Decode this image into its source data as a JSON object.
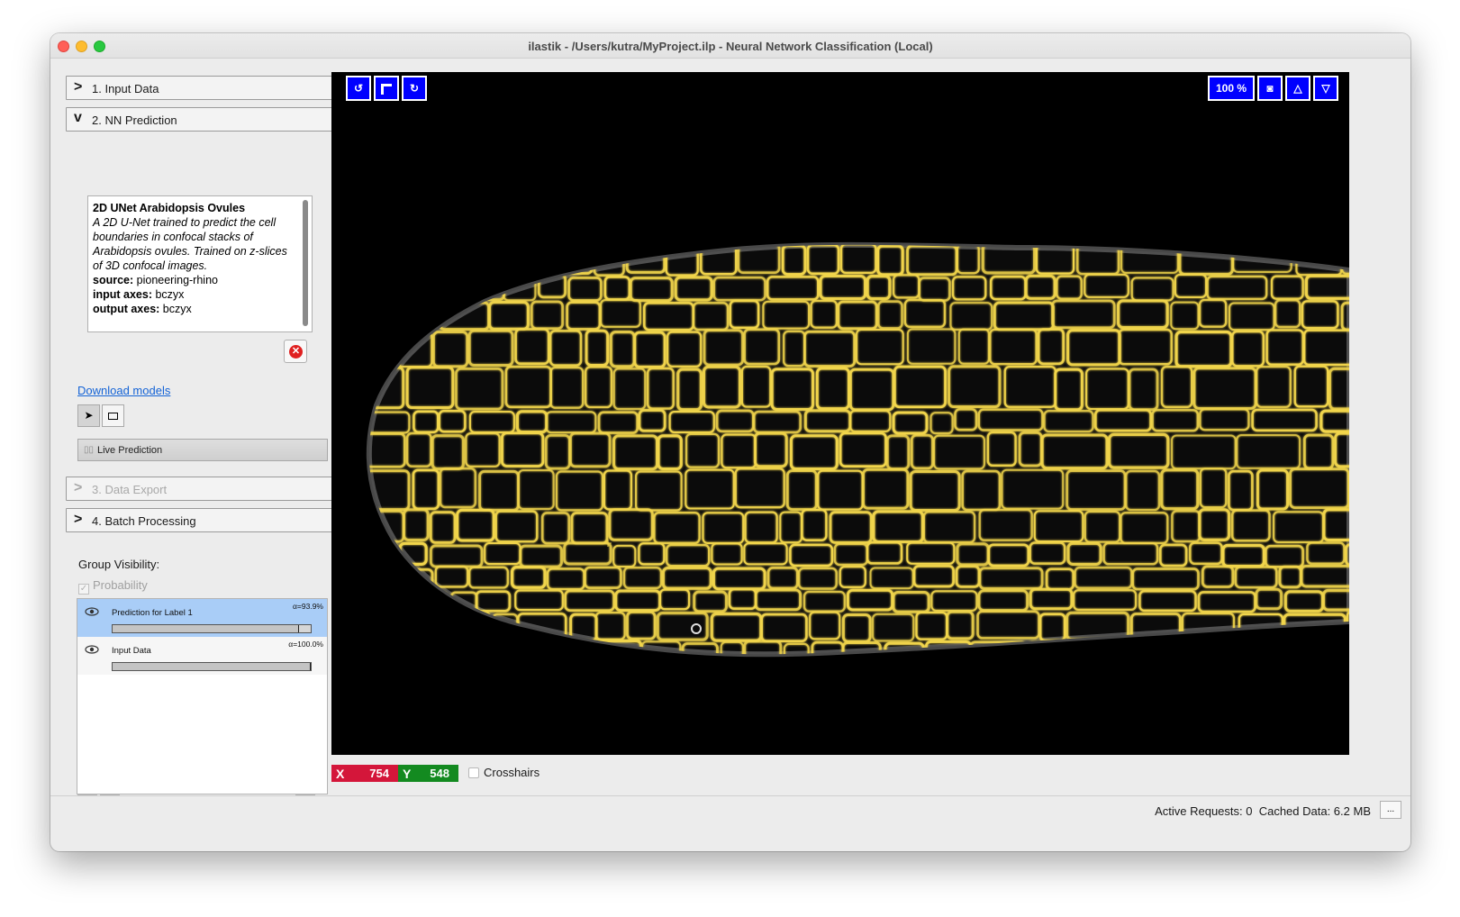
{
  "window": {
    "title": "ilastik - /Users/kutra/MyProject.ilp - Neural Network Classification (Local)"
  },
  "applets": {
    "input_data": {
      "label": "1. Input Data",
      "chevron": ">"
    },
    "nn_prediction": {
      "label": "2. NN Prediction",
      "chevron": "v"
    },
    "data_export": {
      "label": "3. Data Export",
      "chevron": ">"
    },
    "batch_processing": {
      "label": "4. Batch Processing",
      "chevron": ">"
    }
  },
  "model": {
    "name": "2D UNet Arabidopsis Ovules",
    "description": "A 2D U-Net trained to predict the cell boundaries in confocal stacks of Arabidopsis ovules. Trained on z-slices of 3D confocal images.",
    "source_label": "source:",
    "source_value": "pioneering-rhino",
    "input_axes_label": "input axes:",
    "input_axes_value": "bczyx",
    "output_axes_label": "output axes:",
    "output_axes_value": "bczyx"
  },
  "download_models": "Download models",
  "live_prediction": "Live Prediction",
  "group_visibility": {
    "label": "Group Visibility:",
    "probability": "Probability",
    "probability_checked": true
  },
  "layers": [
    {
      "name": "Prediction for Label 1",
      "alpha": "α=93.9%",
      "opacity": 0.939,
      "selected": true
    },
    {
      "name": "Input Data",
      "alpha": "α=100.0%",
      "opacity": 1.0,
      "selected": false
    }
  ],
  "viewer": {
    "zoom": "100 %",
    "cell_color": "#f2d64b",
    "cursor_marker": "+"
  },
  "coords": {
    "x_label": "X",
    "x_value": "754",
    "x_color": "#d4163a",
    "y_label": "Y",
    "y_value": "548",
    "y_color": "#138a20"
  },
  "crosshairs": {
    "label": "Crosshairs",
    "checked": false
  },
  "status": {
    "active_requests": "Active Requests: 0",
    "cached_data": "Cached Data: 6.2 MB",
    "more_button": "..."
  }
}
